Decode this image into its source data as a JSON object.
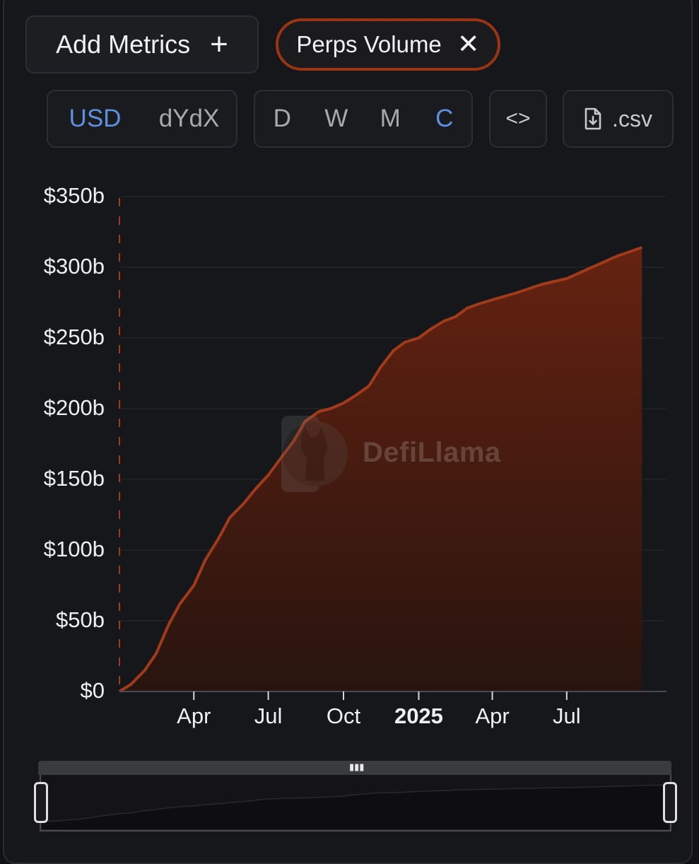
{
  "toolbar": {
    "add_metrics_label": "Add Metrics",
    "add_metrics_icon": "plus-icon",
    "metric_chip_label": "Perps Volume",
    "metric_chip_icon": "close-icon",
    "unit_options": [
      {
        "label": "USD",
        "active": true
      },
      {
        "label": "dYdX",
        "active": false
      }
    ],
    "period_options": [
      {
        "label": "D",
        "active": false
      },
      {
        "label": "W",
        "active": false
      },
      {
        "label": "M",
        "active": false
      },
      {
        "label": "C",
        "active": true
      }
    ],
    "embed_icon": "code-icon",
    "csv_icon": "file-download-icon",
    "csv_label": ".csv"
  },
  "watermark": {
    "text": "DefiLlama",
    "icon": "llama-logo-icon"
  },
  "colors": {
    "line": "#a03b1c",
    "area_top": "#6a230f",
    "active": "#5e8fe0",
    "chip_border": "#9a3412"
  },
  "chart_data": {
    "type": "area",
    "title": "",
    "xlabel": "",
    "ylabel": "",
    "y_tick_labels": [
      "$0",
      "$50b",
      "$100b",
      "$150b",
      "$200b",
      "$250b",
      "$300b",
      "$350b"
    ],
    "y_ticks": [
      0,
      50,
      100,
      150,
      200,
      250,
      300,
      350
    ],
    "ylim": [
      0,
      350
    ],
    "x_tick_labels": [
      {
        "label": "Apr",
        "date": "2024-04-01",
        "bold": false
      },
      {
        "label": "Jul",
        "date": "2024-07-01",
        "bold": false
      },
      {
        "label": "Oct",
        "date": "2024-10-01",
        "bold": false
      },
      {
        "label": "2025",
        "date": "2025-01-01",
        "bold": true
      },
      {
        "label": "Apr",
        "date": "2025-04-01",
        "bold": false
      },
      {
        "label": "Jul",
        "date": "2025-07-01",
        "bold": false
      }
    ],
    "xlim": [
      "2024-01-01",
      "2025-10-31"
    ],
    "grid": true,
    "cumulative": true,
    "series": [
      {
        "unit": "USD billions",
        "points": [
          [
            "2024-01-01",
            0
          ],
          [
            "2024-01-15",
            5
          ],
          [
            "2024-02-01",
            15
          ],
          [
            "2024-02-15",
            27
          ],
          [
            "2024-03-01",
            47
          ],
          [
            "2024-03-15",
            62
          ],
          [
            "2024-04-01",
            75
          ],
          [
            "2024-04-15",
            93
          ],
          [
            "2024-05-01",
            108
          ],
          [
            "2024-05-15",
            123
          ],
          [
            "2024-06-01",
            133
          ],
          [
            "2024-06-15",
            143
          ],
          [
            "2024-07-01",
            153
          ],
          [
            "2024-07-15",
            164
          ],
          [
            "2024-08-01",
            177
          ],
          [
            "2024-08-15",
            191
          ],
          [
            "2024-09-01",
            198
          ],
          [
            "2024-09-15",
            200
          ],
          [
            "2024-10-01",
            204
          ],
          [
            "2024-10-15",
            209
          ],
          [
            "2024-11-01",
            216
          ],
          [
            "2024-11-15",
            229
          ],
          [
            "2024-12-01",
            241
          ],
          [
            "2024-12-15",
            247
          ],
          [
            "2025-01-01",
            250
          ],
          [
            "2025-01-15",
            256
          ],
          [
            "2025-02-01",
            262
          ],
          [
            "2025-02-15",
            265
          ],
          [
            "2025-03-01",
            271
          ],
          [
            "2025-03-15",
            274
          ],
          [
            "2025-04-01",
            277
          ],
          [
            "2025-05-01",
            282
          ],
          [
            "2025-06-01",
            288
          ],
          [
            "2025-07-01",
            292
          ],
          [
            "2025-08-01",
            300
          ],
          [
            "2025-09-01",
            308
          ],
          [
            "2025-10-01",
            314
          ]
        ]
      }
    ]
  }
}
